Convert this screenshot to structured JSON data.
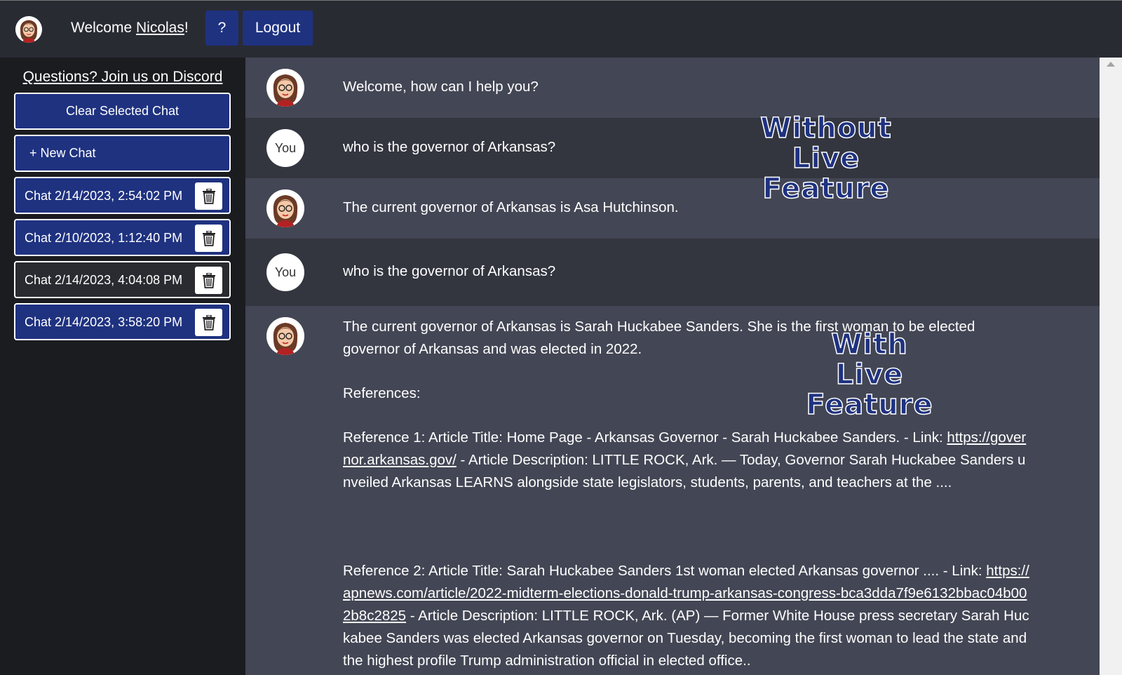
{
  "header": {
    "welcome_prefix": "Welcome ",
    "username": "Nicolas",
    "welcome_suffix": "!",
    "help_label": "?",
    "logout_label": "Logout"
  },
  "sidebar": {
    "discord_link": "Questions? Join us on Discord",
    "clear_label": "Clear Selected Chat",
    "new_chat_label": "+ New Chat",
    "chats": [
      {
        "label": "Chat 2/14/2023, 2:54:02 PM",
        "selected": false
      },
      {
        "label": "Chat 2/10/2023, 1:12:40 PM",
        "selected": false
      },
      {
        "label": "Chat 2/14/2023, 4:04:08 PM",
        "selected": true
      },
      {
        "label": "Chat 2/14/2023, 3:58:20 PM",
        "selected": false
      }
    ]
  },
  "conversation": {
    "you_label": "You",
    "m1": "Welcome, how can I help you?",
    "m2": "who is the governor of Arkansas?",
    "m3": "The current governor of Arkansas is Asa Hutchinson.",
    "m4": "who is the governor of Arkansas?",
    "m5": {
      "answer": "The current governor of Arkansas is Sarah Huckabee Sanders. She is the first woman to be elected governor of Arkansas and was elected in 2022.",
      "references_heading": "References:",
      "ref1_prefix": "Reference 1: Article Title: Home Page - Arkansas Governor - Sarah Huckabee Sanders. - Link: ",
      "ref1_link": "https://governor.arkansas.gov/",
      "ref1_suffix": " - Article Description: LITTLE ROCK, Ark. — Today, Governor Sarah Huckabee Sanders unveiled Arkansas LEARNS alongside state legislators, students, parents, and teachers at the ....",
      "ref2_prefix": "Reference 2: Article Title: Sarah Huckabee Sanders 1st woman elected Arkansas governor .... - Link: ",
      "ref2_link": "https://apnews.com/article/2022-midterm-elections-donald-trump-arkansas-congress-bca3dda7f9e6132bbac04b002b8c2825",
      "ref2_suffix": " - Article Description: LITTLE ROCK, Ark. (AP) — Former White House press secretary Sarah Huckabee Sanders was elected Arkansas governor on Tuesday, becoming the first woman to lead the state and the highest profile Trump administration official in elected office.."
    }
  },
  "annotations": {
    "without": [
      "Without",
      "Live",
      "Feature"
    ],
    "with": [
      "With",
      "Live",
      "Feature"
    ]
  },
  "colors": {
    "accent": "#1f3280",
    "topbar": "#292b33",
    "sidebar": "#1b1c20",
    "ai_row": "#434654",
    "user_row": "#33353f"
  }
}
